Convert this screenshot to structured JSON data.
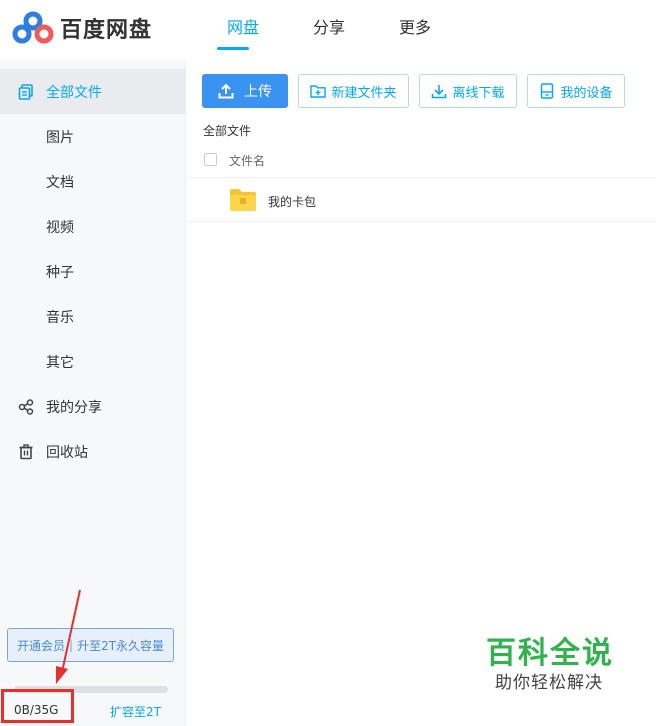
{
  "header": {
    "logo_text": "百度网盘",
    "nav": [
      {
        "label": "网盘",
        "active": true
      },
      {
        "label": "分享",
        "active": false
      },
      {
        "label": "更多",
        "active": false
      }
    ]
  },
  "sidebar": {
    "items": [
      {
        "label": "全部文件",
        "icon": "files-icon",
        "active": true
      },
      {
        "label": "图片"
      },
      {
        "label": "文档"
      },
      {
        "label": "视频"
      },
      {
        "label": "种子"
      },
      {
        "label": "音乐"
      },
      {
        "label": "其它"
      },
      {
        "label": "我的分享",
        "icon": "share-icon"
      },
      {
        "label": "回收站",
        "icon": "trash-icon"
      }
    ],
    "vip_open": "开通会员",
    "vip_upgrade": "升至2T永久容量",
    "quota": "0B/35G",
    "quota_used_fraction": 0,
    "expand": "扩容至2T"
  },
  "toolbar": {
    "upload": "上传",
    "new_folder": "新建文件夹",
    "offline_download": "离线下载",
    "my_devices": "我的设备"
  },
  "breadcrumb": "全部文件",
  "list": {
    "column_name": "文件名",
    "rows": [
      {
        "name": "我的卡包",
        "type": "folder"
      }
    ]
  },
  "watermark": {
    "title": "百科全说",
    "subtitle": "助你轻松解决"
  },
  "colors": {
    "accent": "#06a7ff",
    "upload_button": "#3a93f0",
    "highlight_box": "#e5312d",
    "watermark": "#2fb34a"
  }
}
